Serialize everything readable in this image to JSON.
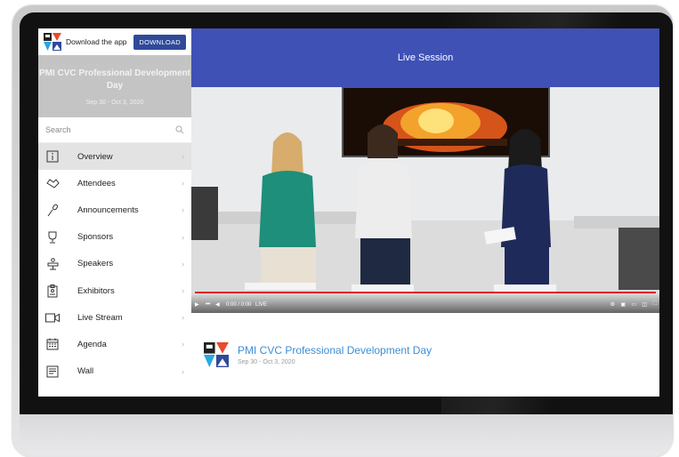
{
  "app_bar": {
    "download_text": "Download the app",
    "download_button": "DOWNLOAD"
  },
  "event": {
    "title": "PMI CVC Professional Development Day",
    "dates": "Sep 30 - Oct 3, 2020"
  },
  "search": {
    "placeholder": "Search"
  },
  "nav": [
    {
      "label": "Overview",
      "icon": "info-icon",
      "active": true
    },
    {
      "label": "Attendees",
      "icon": "handshake-icon"
    },
    {
      "label": "Announcements",
      "icon": "microphone-icon"
    },
    {
      "label": "Sponsors",
      "icon": "trophy-icon"
    },
    {
      "label": "Speakers",
      "icon": "podium-icon"
    },
    {
      "label": "Exhibitors",
      "icon": "badge-icon"
    },
    {
      "label": "Live Stream",
      "icon": "video-camera-icon"
    },
    {
      "label": "Agenda",
      "icon": "calendar-icon"
    },
    {
      "label": "Wall",
      "icon": "wall-icon"
    }
  ],
  "main": {
    "header_title": "Live Session"
  },
  "player": {
    "time": "0:00 / 0:00",
    "live_label": "LIVE"
  },
  "colors": {
    "accent": "#3f51b5",
    "download_btn": "#2f4a9a",
    "link_blue": "#3b8fd6",
    "progress": "#e21d1d"
  }
}
